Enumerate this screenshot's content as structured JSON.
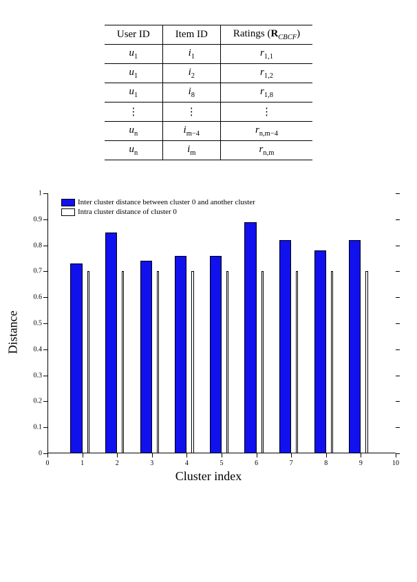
{
  "table": {
    "headers": [
      "User ID",
      "Item ID",
      "Ratings (R_CBCF)"
    ],
    "header_ratings_html": "Ratings (<b>R</b><sub><i>CBCF</i></sub>)",
    "rows": [
      {
        "user": "u_1",
        "item": "i_1",
        "rating": "r_{1,1}"
      },
      {
        "user": "u_1",
        "item": "i_2",
        "rating": "r_{1,2}"
      },
      {
        "user": "u_1",
        "item": "i_8",
        "rating": "r_{1,8}"
      },
      {
        "vdots": true
      },
      {
        "user": "u_n",
        "item": "i_{m-4}",
        "rating": "r_{n,m-4}"
      },
      {
        "user": "u_n",
        "item": "i_m",
        "rating": "r_{n,m}"
      }
    ]
  },
  "chart_data": {
    "type": "bar",
    "xlabel": "Cluster index",
    "ylabel": "Distance",
    "xlim": [
      0,
      10
    ],
    "ylim": [
      0,
      1.0
    ],
    "yticks": [
      0,
      0.1,
      0.2,
      0.3,
      0.4,
      0.5,
      0.6,
      0.7,
      0.8,
      0.9,
      1.0
    ],
    "xticks": [
      0,
      1,
      2,
      3,
      4,
      5,
      6,
      7,
      8,
      9,
      10
    ],
    "categories": [
      1,
      2,
      3,
      4,
      5,
      6,
      7,
      8,
      9
    ],
    "series": [
      {
        "name": "Inter cluster distance between cluster 0 and another cluster",
        "color": "#1111ee",
        "values": [
          0.73,
          0.85,
          0.74,
          0.76,
          0.76,
          0.89,
          0.82,
          0.78,
          0.82
        ]
      },
      {
        "name": "Intra cluster distance of cluster 0",
        "color": "#ffffff",
        "values": [
          0.7,
          0.7,
          0.7,
          0.7,
          0.7,
          0.7,
          0.7,
          0.7,
          0.7
        ]
      }
    ]
  }
}
